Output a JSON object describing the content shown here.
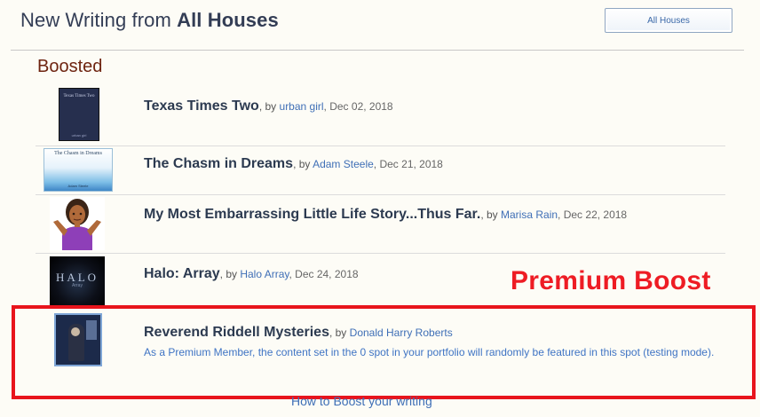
{
  "header": {
    "title_prefix": "New Writing from ",
    "title_scope": "All Houses",
    "filter_button": "All Houses"
  },
  "section": {
    "title": "Boosted"
  },
  "items": [
    {
      "title": "Texas Times Two",
      "by": ", by ",
      "author": "urban girl",
      "date": ", Dec 02, 2018",
      "thumb_text": "Texas Times Two",
      "thumb_footer": "urban girl"
    },
    {
      "title": "The Chasm in Dreams",
      "by": ", by ",
      "author": "Adam Steele",
      "date": ", Dec 21, 2018",
      "thumb_text": "The Chasm in Dreams",
      "thumb_footer": "Adam Steele"
    },
    {
      "title": "My Most Embarrassing Little Life Story...Thus Far.",
      "by": ", by ",
      "author": "Marisa Rain",
      "date": ", Dec 22, 2018"
    },
    {
      "title": "Halo: Array",
      "by": ", by ",
      "author": "Halo Array",
      "date": ", Dec 24, 2018",
      "thumb_text": "HALO",
      "thumb_sub": "Array"
    },
    {
      "title": "Reverend Riddell Mysteries",
      "by": ", by ",
      "author": "Donald Harry Roberts",
      "note": "As a Premium Member, the content set in the 0 spot in your portfolio will randomly be featured in this spot (testing mode)."
    }
  ],
  "annotation": {
    "label": "Premium Boost"
  },
  "footer": {
    "link": "How to Boost your writing"
  },
  "colors": {
    "annotation_red": "#ee1c24",
    "link_blue": "#3f6fb6",
    "section_brown": "#6e2410"
  }
}
